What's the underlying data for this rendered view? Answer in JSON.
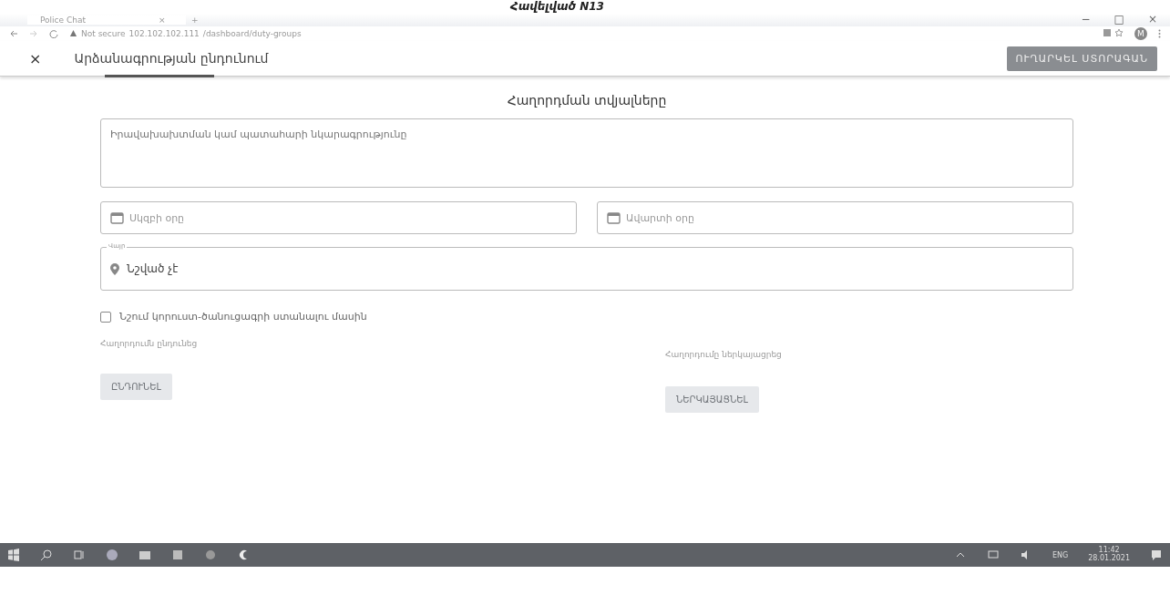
{
  "document_heading": "Հավելված N13",
  "browser": {
    "tab_title": "Police Chat",
    "tab_close": "×",
    "new_tab": "+",
    "security": "Not secure",
    "url_host": "102.102.102.111",
    "url_path": "/dashboard/duty-groups",
    "profile_initial": "M",
    "window_controls": [
      "−",
      "□",
      "×"
    ]
  },
  "app_header": {
    "close": "×",
    "title": "Արձանագրության ընդունում",
    "action_button": "ՈՒՂԱՐԿԵԼ ՍՏՈՐԱԳԱՆ"
  },
  "form": {
    "section_title": "Հաղորդման տվյալները",
    "description": {
      "placeholder": "Իրավախախտման կամ պատահարի նկարագրությունը"
    },
    "dates": [
      {
        "placeholder": "Սկզբի օրը"
      },
      {
        "placeholder": "Ավարտի օրը"
      }
    ],
    "location": {
      "label": "Վայր",
      "value": "Նշված չէ"
    },
    "checkbox": {
      "label": "Նշում կորուստ-ծանուցագրի ստանալու մասին",
      "checked": false
    },
    "signers": [
      {
        "label": "Հաղորդումն ընդունեց",
        "button": "ԸՆԴՈՒՆԵԼ",
        "disabled": true
      },
      {
        "label": "Հաղորդումը ներկայացրեց",
        "button": "ՆԵՐԿԱՅԱՑՆԵԼ",
        "disabled": true
      }
    ]
  },
  "taskbar": {
    "language": "ENG",
    "time": "11:42",
    "date": "28.01.2021"
  }
}
